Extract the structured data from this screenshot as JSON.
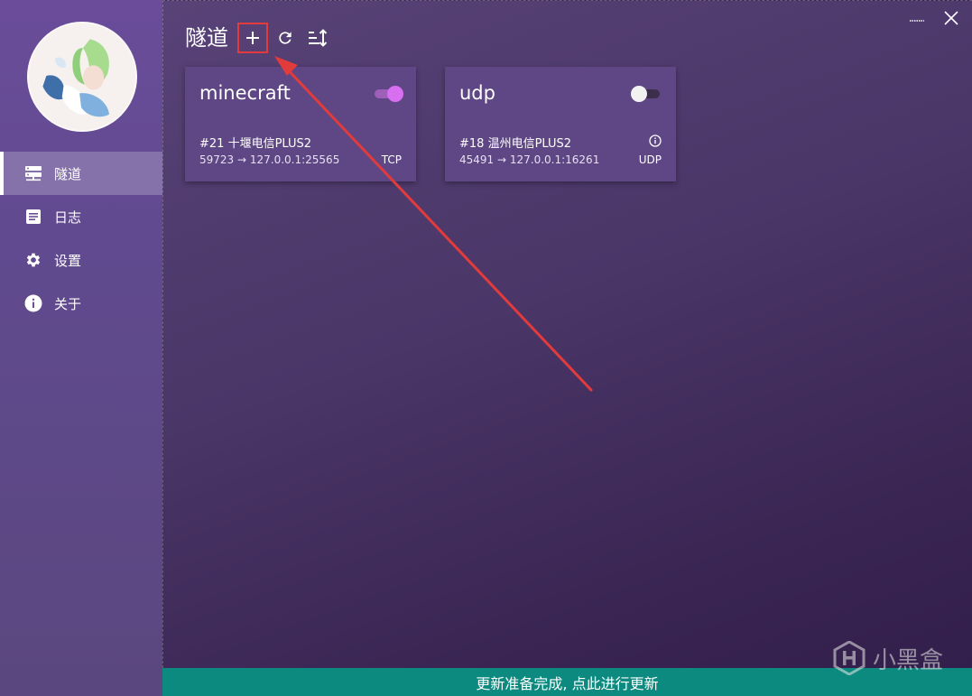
{
  "sidebar": {
    "items": [
      {
        "label": "隧道",
        "icon": "server-icon",
        "active": true
      },
      {
        "label": "日志",
        "icon": "document-icon",
        "active": false
      },
      {
        "label": "设置",
        "icon": "gear-icon",
        "active": false
      },
      {
        "label": "关于",
        "icon": "info-icon",
        "active": false
      }
    ]
  },
  "header": {
    "title": "隧道",
    "actions": [
      "plus-icon",
      "refresh-icon",
      "sort-icon"
    ]
  },
  "tunnels": [
    {
      "name": "minecraft",
      "enabled": true,
      "node": "#21 十堰电信PLUS2",
      "mapping": "59723 → 127.0.0.1:25565",
      "protocol": "TCP",
      "has_info": false
    },
    {
      "name": "udp",
      "enabled": false,
      "node": "#18 温州电信PLUS2",
      "mapping": "45491 → 127.0.0.1:16261",
      "protocol": "UDP",
      "has_info": true
    }
  ],
  "statusbar": {
    "message": "更新准备完成, 点此进行更新"
  },
  "watermark": {
    "text": "小黑盒"
  },
  "colors": {
    "accent_toggle": "#d86ff0",
    "status_bar": "#0d8a7f",
    "annotation": "#e23b3b"
  }
}
